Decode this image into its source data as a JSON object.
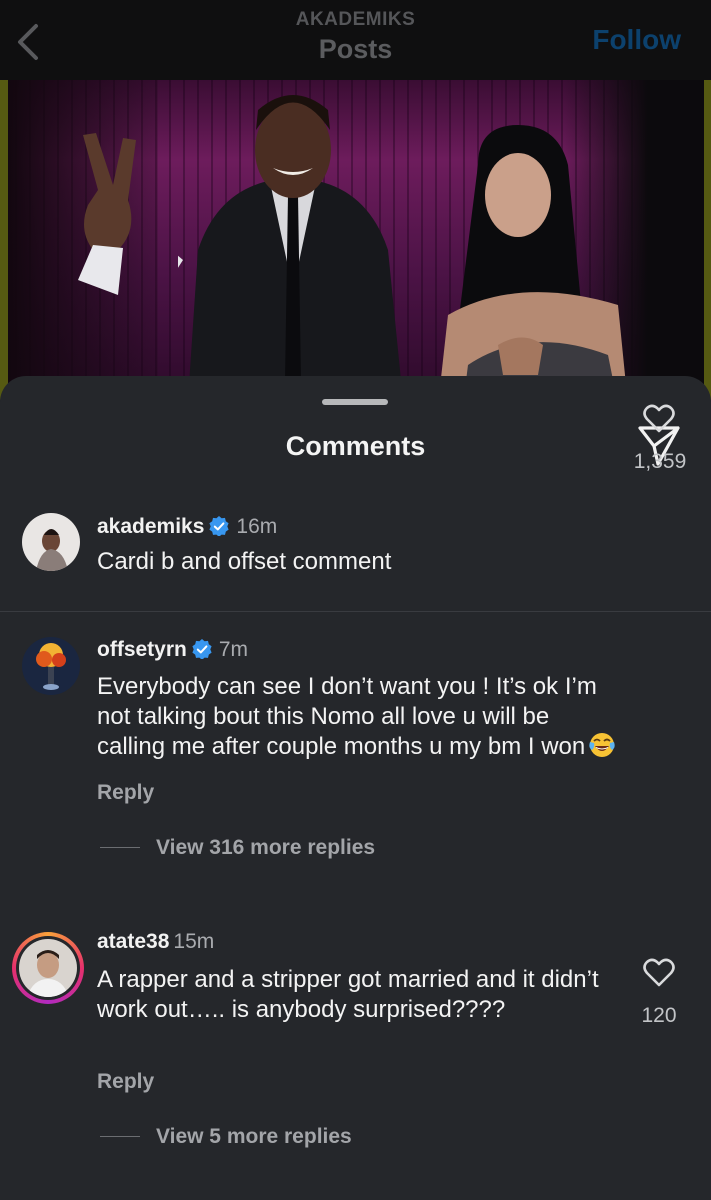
{
  "header": {
    "account": "AKADEMIKS",
    "title": "Posts",
    "follow_label": "Follow"
  },
  "sheet": {
    "title": "Comments"
  },
  "comments": [
    {
      "username": "akademiks",
      "verified": true,
      "time": "16m",
      "text": "Cardi b and offset comment"
    },
    {
      "username": "offsetyrn",
      "verified": true,
      "time": "7m",
      "text": "Everybody can see I don’t want you ! It’s ok I’m not talking bout this Nomo all love u will be calling me after couple months u my bm I won",
      "emoji": "face-with-tears-of-joy",
      "likes": "1,359",
      "reply_label": "Reply",
      "view_replies": "View 316 more replies"
    },
    {
      "username": "atate38",
      "verified": false,
      "time": "15m",
      "text": "A rapper and a stripper got married and it didn’t work out….. is anybody surprised????",
      "likes": "120",
      "reply_label": "Reply",
      "view_replies": "View 5 more replies",
      "story_ring": true
    }
  ],
  "colors": {
    "sheet_bg": "#25272b",
    "follow_blue": "#0c416d",
    "verified_blue": "#3897f0",
    "muted_text": "#a3a5a9"
  }
}
